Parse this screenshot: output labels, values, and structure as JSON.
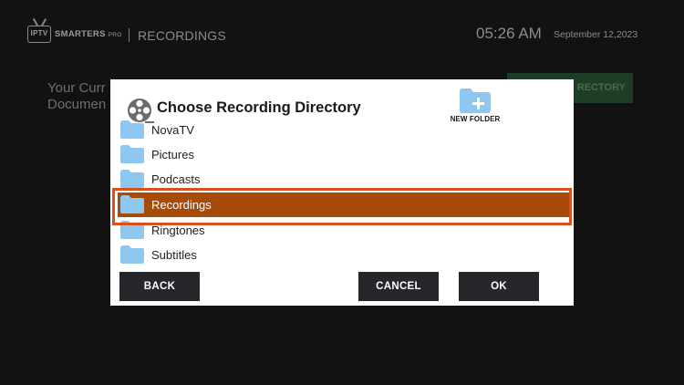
{
  "app": {
    "logo_text": "IPTV SMARTERS PRO",
    "logo_tv": "IPTV",
    "logo_brand": "SMARTERS",
    "logo_pro": "PRO",
    "section": "RECORDINGS",
    "time": "05:26 AM",
    "date": "September 12,2023"
  },
  "background": {
    "info_line1": "Your Curr",
    "info_line2": "Documen",
    "button_label": "RECTORY",
    "button_color": "#1d3d26"
  },
  "dialog": {
    "title": "Choose Recording Directory",
    "title_icon": "film-reel-icon",
    "new_folder_label": "NEW FOLDER",
    "new_folder_icon": "folder-plus-icon",
    "folders": [
      {
        "name": "NovaTV",
        "selected": false
      },
      {
        "name": "Pictures",
        "selected": false
      },
      {
        "name": "Podcasts",
        "selected": false
      },
      {
        "name": "Recordings",
        "selected": true
      },
      {
        "name": "Ringtones",
        "selected": false
      },
      {
        "name": "Subtitles",
        "selected": false
      }
    ],
    "buttons": {
      "back": "BACK",
      "cancel": "CANCEL",
      "ok": "OK"
    },
    "colors": {
      "selected_row": "#a64c08",
      "focus_outline": "#d8501c",
      "folder": "#8ec8f0",
      "button_bg": "#25272a"
    }
  }
}
